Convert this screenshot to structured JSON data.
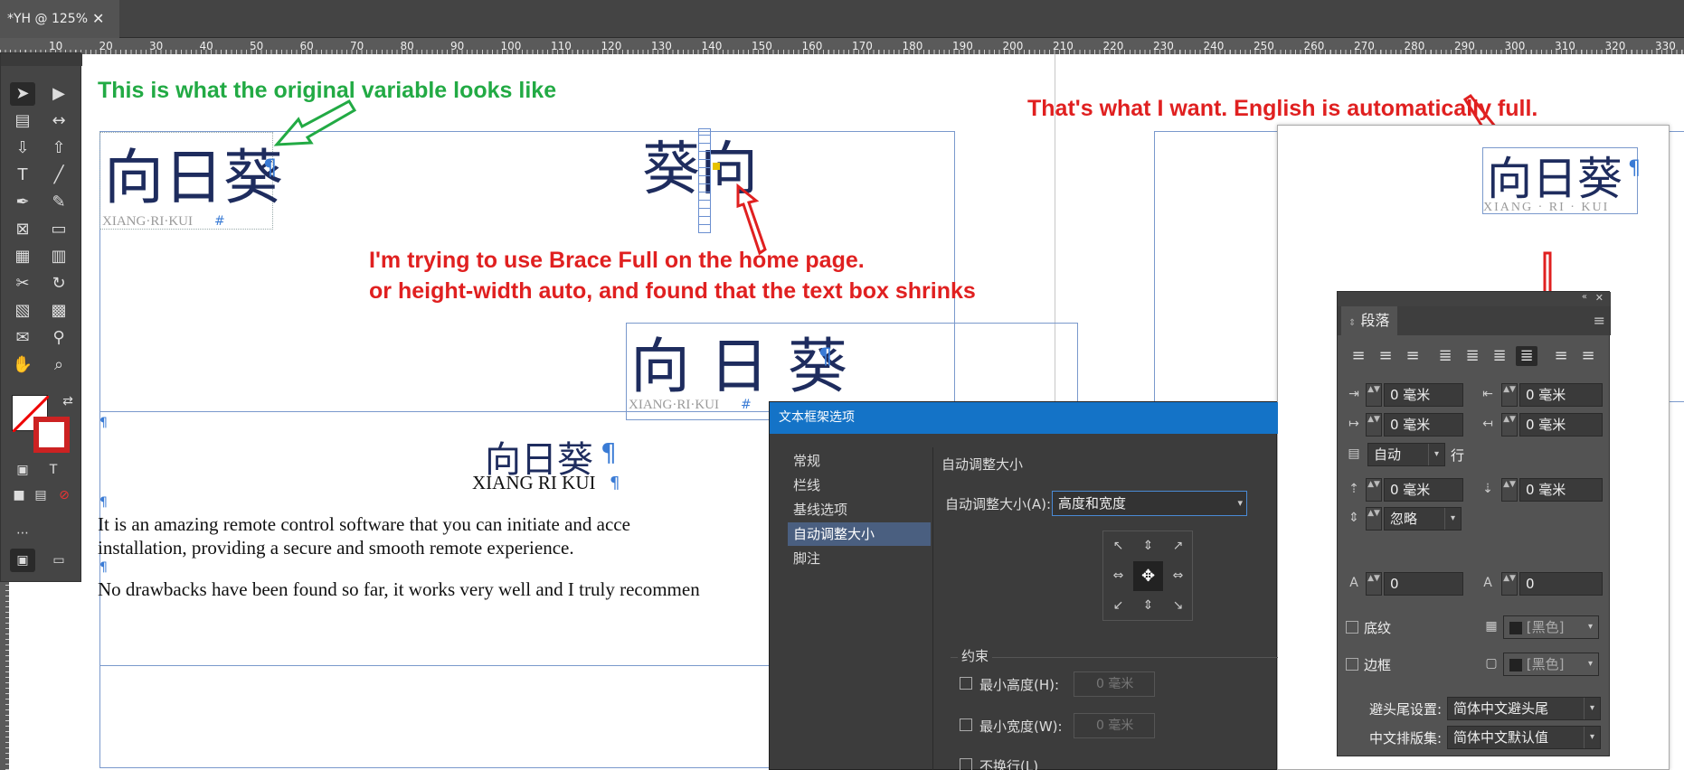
{
  "document_tab": {
    "title": "*YH @ 125%",
    "close": "✕"
  },
  "ruler_ticks": [
    "10",
    "20",
    "30",
    "40",
    "50",
    "60",
    "70",
    "80",
    "90",
    "100",
    "110",
    "120",
    "130",
    "140",
    "150",
    "160",
    "170",
    "180",
    "190",
    "200",
    "210",
    "220",
    "230",
    "240",
    "250",
    "260",
    "270",
    "280",
    "290",
    "300",
    "310",
    "320",
    "330"
  ],
  "annotations": {
    "green": "This is what the original variable looks like",
    "red_top_right": "That's what I want. English is automatically full.",
    "red_middle_1": "I'm trying to use Brace Full on the home page.",
    "red_middle_2": "or height-width auto, and found that the text box shrinks"
  },
  "layout_samples": {
    "original_title": "向日葵",
    "original_sub": "XIANG·RI·KUI",
    "broken_title": "葵向",
    "shrunk_title": "向 日 葵",
    "shrunk_sub": "XIANG·RI·KUI",
    "wanted_title": "向日葵",
    "wanted_sub": "XIANG · RI · KUI",
    "pilcrow": "¶",
    "endmark": "#"
  },
  "page_text": {
    "title": "向日葵",
    "subtitle": "XIANG RI KUI",
    "p1_line1": "It is an amazing remote control software that you can initiate and acce",
    "p1_line2": "installation, providing a secure and smooth remote experience.",
    "p2": "No drawbacks have been found so far, it works very well and I truly recommen"
  },
  "dialog": {
    "title": "文本框架选项",
    "nav": [
      "常规",
      "栏线",
      "基线选项",
      "自动调整大小",
      "脚注"
    ],
    "active_nav": 3,
    "section": "自动调整大小",
    "autosize_label": "自动调整大小(A):",
    "autosize_value": "高度和宽度",
    "constraints": "约束",
    "min_height": "最小高度(H):",
    "min_width": "最小宽度(W):",
    "min_value": "0 毫米",
    "no_wrap": "不换行(L)"
  },
  "paragraph_panel": {
    "tab": "段落",
    "left_indent": "0 毫米",
    "right_indent": "0 毫米",
    "first_indent": "0 毫米",
    "last_indent": "0 毫米",
    "grid_label": "自动",
    "grid_unit": "行",
    "space_before": "0 毫米",
    "space_after": "0 毫米",
    "ignore": "忽略",
    "dropcap_lines": "0",
    "dropcap_chars": "0",
    "shading": "底纹",
    "border": "边框",
    "black": "[黑色]",
    "kinsoku_label": "避头尾设置:",
    "kinsoku_value": "简体中文避头尾",
    "mojikumi_label": "中文排版集:",
    "mojikumi_value": "简体中文默认值"
  },
  "colors": {
    "annotation_red": "#e02020",
    "annotation_green": "#22aa44",
    "dialog_title": "#1473c7",
    "frame_blue": "#7a99cc"
  }
}
